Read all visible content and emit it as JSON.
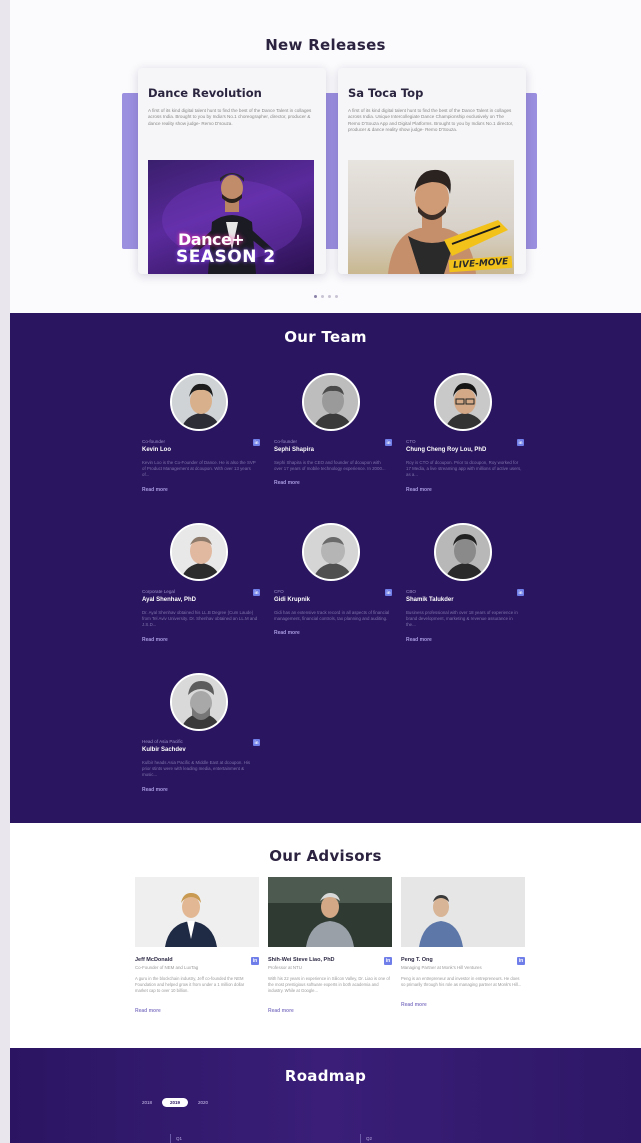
{
  "releases": {
    "title": "New Releases",
    "cards": [
      {
        "title": "Dance Revolution",
        "desc": "A first of its kind digital talent hunt to find the best of the Dance Talent in collages across India. Brought to you by India's No.1 choreographer, director, producer & dance reality show judge- Remo D'souza.",
        "thumb_text_1": "Dance+",
        "thumb_text_2": "SEASON 2"
      },
      {
        "title": "Sa Toca Top",
        "desc": "A first of its kind digital talent hunt to find the best of the Dance Talent in collages across India. Unique Intercollegiate Dance Championship exclusively on The Remo D'Souza App and Digital Platforms. Brought to you by India's No.1 director, producer & dance reality show judge- Remo D'Souza.",
        "thumb_text": "LIVE-MOVE"
      }
    ]
  },
  "team": {
    "title": "Our Team",
    "linkedin": "in",
    "read_more": "Read more",
    "members": [
      {
        "role": "Co-founder",
        "name": "Kevin Loo",
        "bio": "Kevin Loo is the Co-Founder of Dance. He is also the SVP of Product Management at dcoupon. With over 13 years of..."
      },
      {
        "role": "Co-founder",
        "name": "Sephi Shapira",
        "bio": "Sephi Shapira is the CEO and founder of dcoupon with over 17 years of mobile technology experience. In 2000..."
      },
      {
        "role": "CTO",
        "name": "Chung Cheng Roy Lou, PhD",
        "bio": "Roy is CTO of dcoupon. Prior to dcoupon, Roy worked for 17 Media, a live streaming app with millions of active users, as a..."
      },
      {
        "role": "Corporate Legal",
        "name": "Ayal Shenhav, PhD",
        "bio": "Dr. Ayal Shenhav obtained his LL.B Degree (Cum Laude) from Tel Aviv University. Dr. Shenhav obtained an LL.M and J.S.D..."
      },
      {
        "role": "CFO",
        "name": "Gidi Krupnik",
        "bio": "Gidi has an extensive track record in all aspects of financial management, financial controls, tax planning and auditing."
      },
      {
        "role": "CBO",
        "name": "Shamik Talukder",
        "bio": "Business professional with over 18 years of experience in brand development, marketing & revenue assurance in the..."
      },
      {
        "role": "Head of Asia Pacific",
        "name": "Kulbir Sachdev",
        "bio": "Kulbir heads Asia Pacific & Middle East at dcoupon. His prior stints were with leading media, entertainment & music..."
      }
    ]
  },
  "advisors": {
    "title": "Our Advisors",
    "linkedin": "in",
    "read_more": "Read more",
    "people": [
      {
        "name": "Jeff McDonald",
        "role": "Co-Founder of NEM and LuxTag",
        "bio": "A guru in the blockchain industry, Jeff co-founded the NEM Foundation and helped grow it from under a 1 million dollar market cap to over 10 billion."
      },
      {
        "name": "Shih-Wei Steve Liao, PhD",
        "role": "Professor at NTU",
        "bio": "With his 22 years in experience in Silicon Valley, Dr. Liao is one of the most prestigious software experts in both academia and industry. While at Google..."
      },
      {
        "name": "Peng T. Ong",
        "role": "Managing Partner at Monk's Hill Ventures",
        "bio": "Peng is an entrepreneur and investor in entrepreneurs. He does so primarily through his role as managing partner at Monk's Hill..."
      }
    ]
  },
  "roadmap": {
    "title": "Roadmap",
    "years": [
      "2018",
      "2019",
      "2020"
    ],
    "active_year": "2019",
    "steps": [
      "Q1",
      "Q2"
    ]
  },
  "colors": {
    "team_bg": "#2a1560",
    "band": "#9b8fe0",
    "linkedin": "#6f7ee8"
  }
}
